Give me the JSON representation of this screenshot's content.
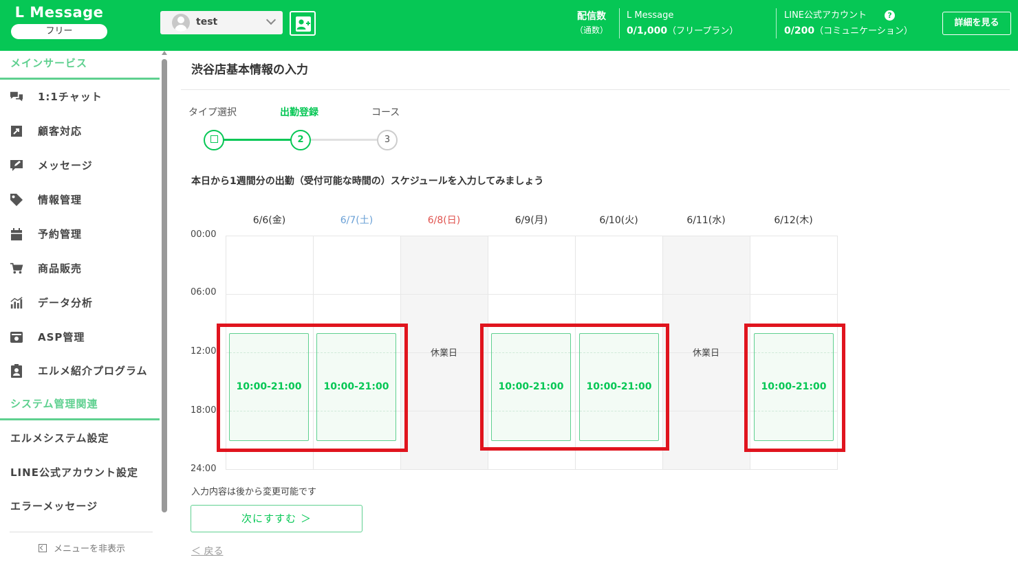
{
  "header": {
    "logo": "L Message",
    "plan_badge": "フリー",
    "account_name": "test",
    "stats": {
      "label": "配信数",
      "label_sub": "（通数）",
      "lmessage_title": "L Message",
      "lmessage_value": "0/1,000",
      "lmessage_note": "（フリープラン）",
      "line_title": "LINE公式アカウント",
      "line_value": "0/200",
      "line_note": "（コミュニケーション）"
    },
    "help_icon": "?",
    "details_button": "詳細を見る",
    "brand_color": "#06c755"
  },
  "sidebar": {
    "section_main": "メインサービス",
    "items": [
      {
        "label": "1:1チャット",
        "icon": "chat-icon"
      },
      {
        "label": "顧客対応",
        "icon": "external-link-icon"
      },
      {
        "label": "メッセージ",
        "icon": "message-edit-icon"
      },
      {
        "label": "情報管理",
        "icon": "tag-icon"
      },
      {
        "label": "予約管理",
        "icon": "calendar-icon"
      },
      {
        "label": "商品販売",
        "icon": "cart-icon"
      },
      {
        "label": "データ分析",
        "icon": "chart-icon"
      },
      {
        "label": "ASP管理",
        "icon": "asp-icon"
      },
      {
        "label": "エルメ紹介プログラム",
        "icon": "clipboard-user-icon"
      }
    ],
    "section_system": "システム管理関連",
    "system_items": [
      {
        "label": "エルメシステム設定"
      },
      {
        "label": "LINE公式アカウント設定"
      },
      {
        "label": "エラーメッセージ"
      }
    ],
    "hide_menu": "メニューを非表示"
  },
  "main": {
    "title": "渋谷店基本情報の入力",
    "steps": [
      {
        "label": "タイプ選択",
        "marker": "",
        "state": "done"
      },
      {
        "label": "出勤登録",
        "marker": "2",
        "state": "current"
      },
      {
        "label": "コース",
        "marker": "3",
        "state": "todo"
      }
    ],
    "instruction": "本日から1週間分の出勤（受付可能な時間の）スケジュールを入力してみましょう",
    "time_labels": [
      "00:00",
      "06:00",
      "12:00",
      "18:00",
      "24:00"
    ],
    "days": [
      {
        "label": "6/6(金)",
        "type": "weekday",
        "slot": "10:00-21:00",
        "off_label": ""
      },
      {
        "label": "6/7(土)",
        "type": "sat",
        "slot": "10:00-21:00",
        "off_label": ""
      },
      {
        "label": "6/8(日)",
        "type": "sun",
        "slot": "",
        "off_label": "休業日"
      },
      {
        "label": "6/9(月)",
        "type": "weekday",
        "slot": "10:00-21:00",
        "off_label": ""
      },
      {
        "label": "6/10(火)",
        "type": "weekday",
        "slot": "10:00-21:00",
        "off_label": ""
      },
      {
        "label": "6/11(水)",
        "type": "weekday",
        "slot": "",
        "off_label": "休業日"
      },
      {
        "label": "6/12(木)",
        "type": "weekday",
        "slot": "10:00-21:00",
        "off_label": ""
      }
    ],
    "note": "入力内容は後から変更可能です",
    "next_button": "次にすすむ ＞",
    "back_link": "＜ 戻る",
    "highlight_color": "#e0141e"
  }
}
